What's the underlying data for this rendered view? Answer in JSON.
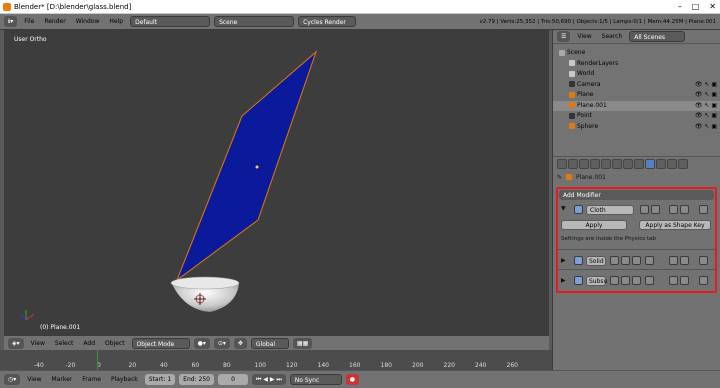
{
  "window": {
    "title": "Blender* [D:\\blender\\glass.blend]",
    "minimize": "–",
    "maximize": "□",
    "close": "✕"
  },
  "info": {
    "menus": [
      "File",
      "Render",
      "Window",
      "Help"
    ],
    "layout": "Default",
    "scene": "Scene",
    "engine": "Cycles Render",
    "stats": "v2.79 | Verts:25,352 | Tris:50,690 | Objects:1/5 | Lamps:0/1 | Mem:44.25M | Plane.001"
  },
  "viewport": {
    "view_name": "User Ortho",
    "object_label": "(0) Plane.001"
  },
  "view_header": {
    "menus": [
      "View",
      "Select",
      "Add",
      "Object"
    ],
    "mode": "Object Mode",
    "orientation": "Global"
  },
  "timeline": {
    "ticks": [
      "-40",
      "-20",
      "0",
      "20",
      "40",
      "60",
      "80",
      "100",
      "120",
      "140",
      "160",
      "180",
      "200",
      "220",
      "240",
      "260"
    ]
  },
  "timeline_footer": {
    "menus": [
      "View",
      "Marker",
      "Frame",
      "Playback"
    ],
    "start_label": "Start:",
    "start": "1",
    "end_label": "End:",
    "end": "250",
    "current": "0",
    "sync": "No Sync"
  },
  "outliner": {
    "menus": [
      "View",
      "Search"
    ],
    "filter": "All Scenes",
    "items": [
      {
        "label": "Scene",
        "indent": 0,
        "color": "#aaaaaa"
      },
      {
        "label": "RenderLayers",
        "indent": 1,
        "color": "#c8c8c8"
      },
      {
        "label": "World",
        "indent": 1,
        "color": "#c8c8c8"
      },
      {
        "label": "Camera",
        "indent": 1,
        "color": "#333333"
      },
      {
        "label": "Plane",
        "indent": 1,
        "color": "#e07a10"
      },
      {
        "label": "Plane.001",
        "indent": 1,
        "color": "#e07a10"
      },
      {
        "label": "Point",
        "indent": 1,
        "color": "#333333"
      },
      {
        "label": "Sphere",
        "indent": 1,
        "color": "#e07a10"
      }
    ]
  },
  "properties": {
    "object": "Plane.001",
    "add_modifier": "Add Modifier",
    "cloth_name": "Cloth",
    "apply": "Apply",
    "apply_shape": "Apply as Shape Key",
    "note": "Settings are inside the Physics tab",
    "solidify_name": "Solid",
    "subsurf_name": "Subsu"
  },
  "colors": {
    "plane": "#0a1a9a",
    "highlight": "#e31b23",
    "viewport": "#3d3d3d"
  }
}
